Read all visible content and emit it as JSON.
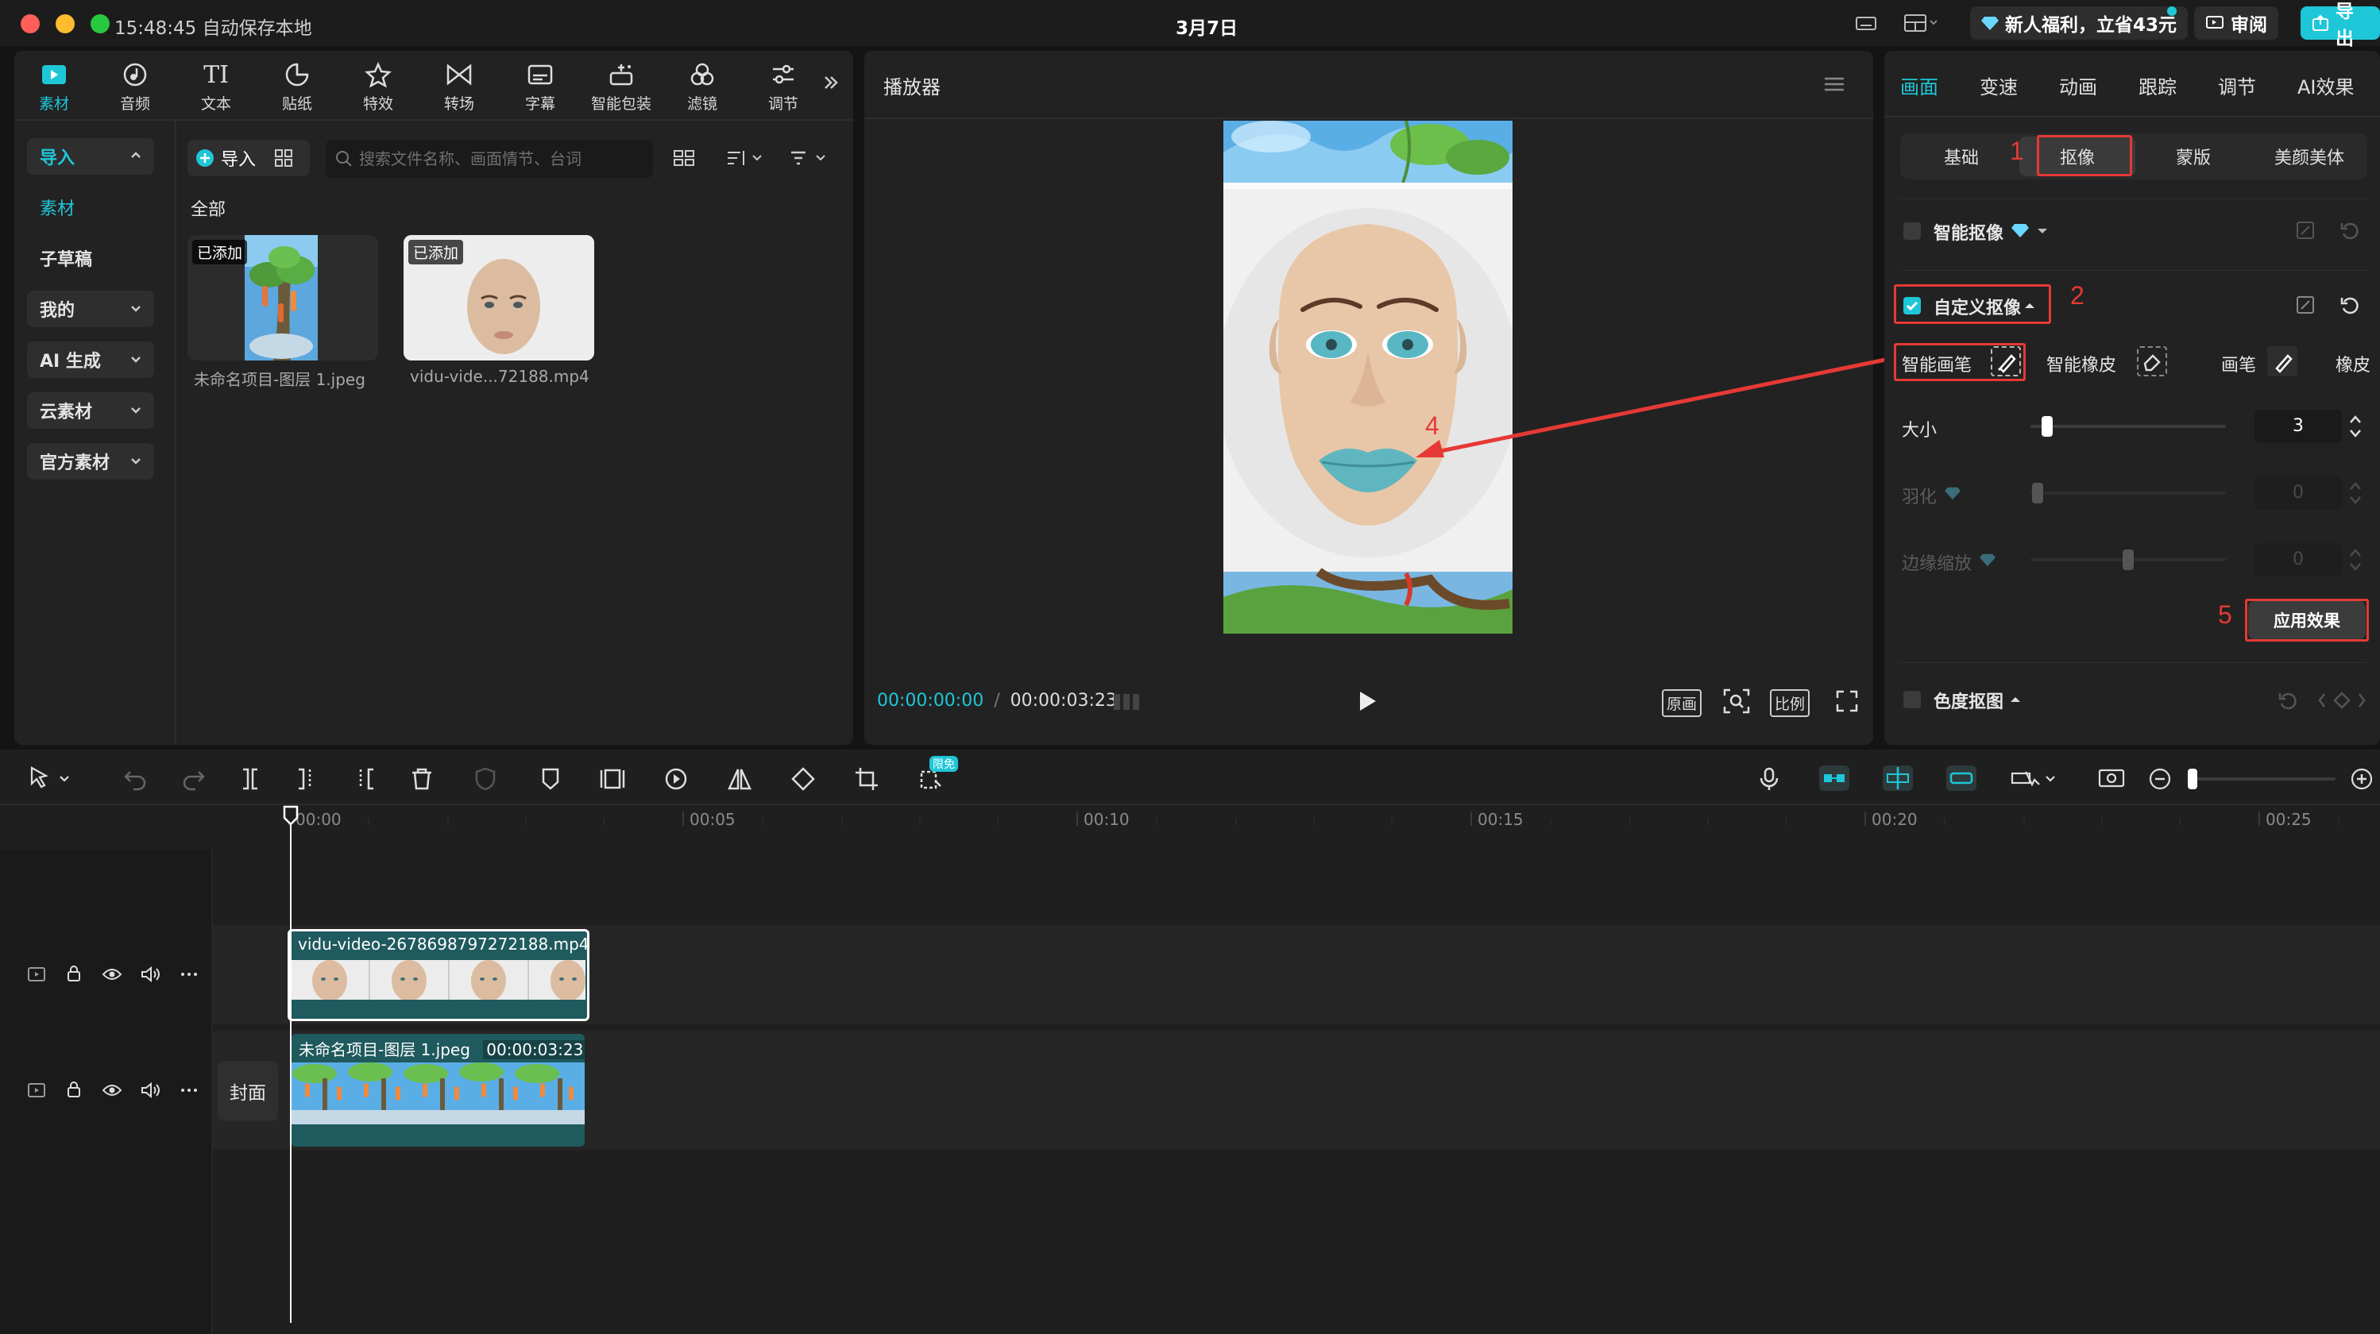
{
  "titlebar": {
    "save_status": "15:48:45 自动保存本地",
    "date_title": "3月7日",
    "promo": "新人福利，立省43元",
    "review": "审阅",
    "export": "导出"
  },
  "toolbar": {
    "tabs": [
      {
        "label": "素材",
        "icon": "media-icon"
      },
      {
        "label": "音频",
        "icon": "audio-icon"
      },
      {
        "label": "文本",
        "icon": "text-icon"
      },
      {
        "label": "贴纸",
        "icon": "sticker-icon"
      },
      {
        "label": "特效",
        "icon": "effects-icon"
      },
      {
        "label": "转场",
        "icon": "transition-icon"
      },
      {
        "label": "字幕",
        "icon": "subtitle-icon"
      },
      {
        "label": "智能包装",
        "icon": "smart-pack-icon"
      },
      {
        "label": "滤镜",
        "icon": "filter-icon"
      },
      {
        "label": "调节",
        "icon": "adjust-icon"
      }
    ]
  },
  "left_nav": {
    "items": [
      "导入",
      "素材",
      "子草稿",
      "我的",
      "AI 生成",
      "云素材",
      "官方素材"
    ]
  },
  "media": {
    "import_label": "导入",
    "search_placeholder": "搜索文件名称、画面情节、台词",
    "section_all": "全部",
    "items": [
      {
        "badge": "已添加",
        "name": "未命名项目-图层 1.jpeg"
      },
      {
        "badge": "已添加",
        "name": "vidu-vide...72188.mp4"
      }
    ]
  },
  "player": {
    "title": "播放器",
    "time_current": "00:00:00:00",
    "separator": "/",
    "time_total": "00:00:03:23",
    "btn_original": "原画",
    "btn_ratio": "比例"
  },
  "right_panel": {
    "tabs": [
      "画面",
      "变速",
      "动画",
      "跟踪",
      "调节",
      "AI效果"
    ],
    "subtabs": [
      "基础",
      "抠像",
      "蒙版",
      "美颜美体"
    ],
    "smart_matting": "智能抠像",
    "custom_matting": "自定义抠像",
    "brushes": [
      "智能画笔",
      "智能橡皮",
      "画笔",
      "橡皮"
    ],
    "size_label": "大小",
    "size_value": "3",
    "size_level": 0.05,
    "feather_label": "羽化",
    "feather_value": "0",
    "edge_label": "边缘缩放",
    "edge_value": "0",
    "apply_label": "应用效果",
    "chroma_key": "色度抠图"
  },
  "annotations": [
    "1",
    "2",
    "4",
    "5"
  ],
  "timeline": {
    "ruler": [
      "00:00",
      "00:05",
      "00:10",
      "00:15",
      "00:20",
      "00:25"
    ],
    "cover_label": "封面",
    "clips": [
      {
        "title": "vidu-video-2678698797272188.mp4"
      },
      {
        "title": "未命名项目-图层 1.jpeg",
        "duration": "00:00:03:23"
      }
    ],
    "badge_free": "限免"
  },
  "colors": {
    "accent": "#1ec7d8",
    "annotation": "#e53935",
    "clip_teal": "#1f5a5e"
  }
}
